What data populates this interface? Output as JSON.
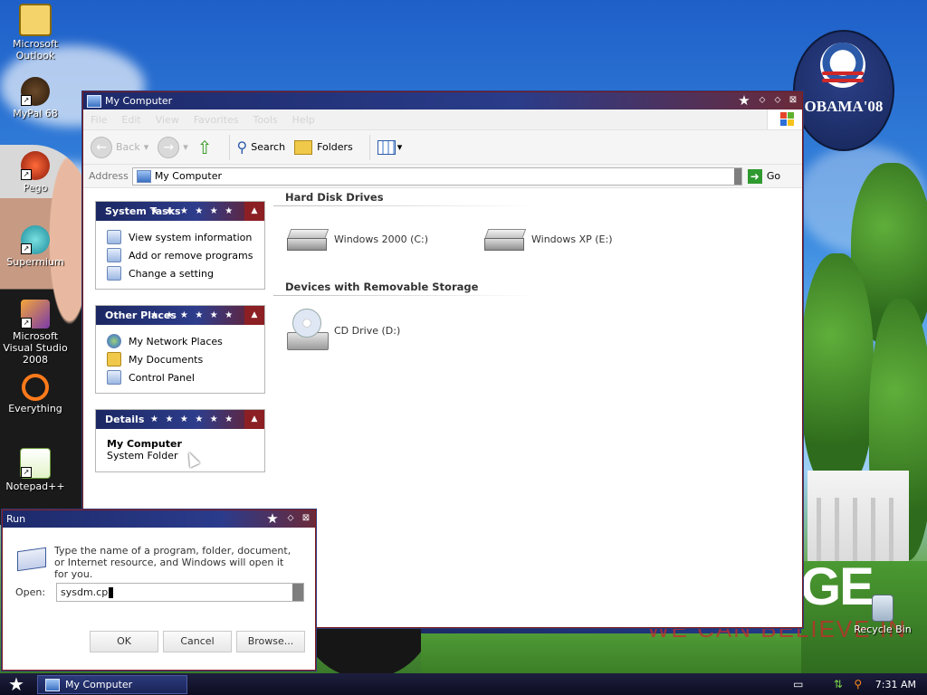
{
  "desktop": {
    "icons": [
      {
        "label": "Microsoft Outlook",
        "icon": "outlook-icon"
      },
      {
        "label": "MyPal 68",
        "icon": "mypal-icon"
      },
      {
        "label": "Pego",
        "icon": "pego-icon"
      },
      {
        "label": "Supermium",
        "icon": "supermium-icon"
      },
      {
        "label": "Microsoft Visual Studio 2008",
        "icon": "visual-studio-icon"
      },
      {
        "label": "Everything",
        "icon": "everything-icon"
      },
      {
        "label": "Notepad++",
        "icon": "notepadpp-icon"
      },
      {
        "label": "Recycle Bin",
        "icon": "recycle-bin-icon"
      }
    ],
    "wallpaper": {
      "logo_text": "OBAMA'08",
      "banner_large": "GE",
      "banner_small": "WE CAN BELIEVE IN"
    }
  },
  "mycomputer": {
    "title": "My Computer",
    "menu": [
      "File",
      "Edit",
      "View",
      "Favorites",
      "Tools",
      "Help"
    ],
    "toolbar": {
      "back": "Back",
      "search": "Search",
      "folders": "Folders"
    },
    "address": {
      "label": "Address",
      "value": "My Computer",
      "go": "Go"
    },
    "panels": {
      "system_tasks": {
        "title": "System Tasks",
        "items": [
          "View system information",
          "Add or remove programs",
          "Change a setting"
        ]
      },
      "other_places": {
        "title": "Other Places",
        "items": [
          "My Network Places",
          "My Documents",
          "Control Panel"
        ]
      },
      "details": {
        "title": "Details",
        "name": "My Computer",
        "type": "System Folder"
      }
    },
    "groups": {
      "hard_disks": {
        "title": "Hard Disk Drives",
        "drives": [
          "Windows 2000 (C:)",
          "Windows XP (E:)"
        ]
      },
      "removable": {
        "title": "Devices with Removable Storage",
        "drives": [
          "CD Drive (D:)"
        ]
      }
    }
  },
  "run_dialog": {
    "title": "Run",
    "description": "Type the name of a program, folder, document, or Internet resource, and Windows will open it for you.",
    "open_label": "Open:",
    "open_value": "sysdm.cp",
    "ok": "OK",
    "cancel": "Cancel",
    "browse": "Browse..."
  },
  "taskbar": {
    "task_label": "My Computer",
    "clock": "7:31 AM"
  },
  "colors": {
    "title_blue": "#1d2a6a",
    "accent_red": "#8b1f24"
  }
}
